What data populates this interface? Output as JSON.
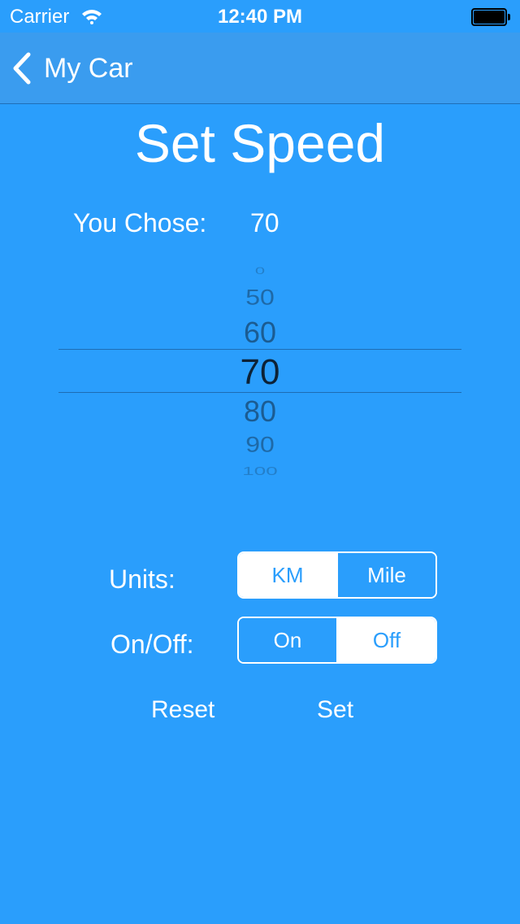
{
  "status_bar": {
    "carrier": "Carrier",
    "time": "12:40 PM"
  },
  "nav": {
    "back_label": "My Car"
  },
  "page": {
    "title": "Set Speed",
    "chose_label": "You Chose:",
    "chose_value": "70"
  },
  "picker": {
    "items": [
      "0",
      "50",
      "60",
      "70",
      "80",
      "90",
      "100"
    ],
    "selected": "70"
  },
  "units": {
    "label": "Units:",
    "options": [
      "KM",
      "Mile"
    ],
    "selected": "KM"
  },
  "power": {
    "label": "On/Off:",
    "options": [
      "On",
      "Off"
    ],
    "selected": "Off"
  },
  "actions": {
    "reset_label": "Reset",
    "set_label": "Set"
  },
  "colors": {
    "background": "#2a9efc",
    "nav_background": "#3a9cef",
    "picker_text": "#17466f"
  }
}
